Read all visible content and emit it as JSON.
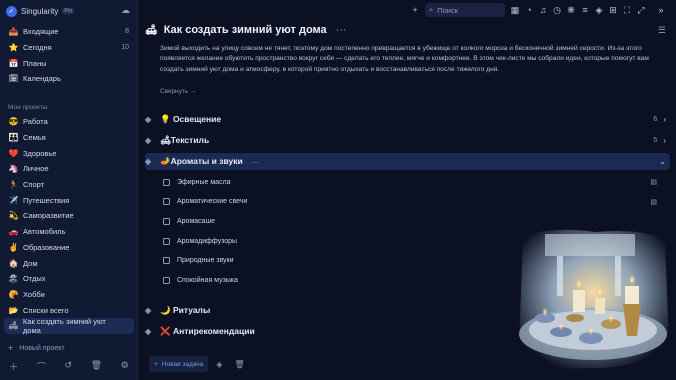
{
  "app": {
    "name": "Singularity",
    "badge": "Pro"
  },
  "sidebar": {
    "items": [
      {
        "label": "Входящие",
        "count": "8",
        "icon": "inbox-icon",
        "glyph": "📥"
      },
      {
        "label": "Сегодня",
        "count": "10",
        "icon": "star-icon",
        "glyph": "⭐"
      },
      {
        "label": "Планы",
        "count": "",
        "icon": "calendar-icon",
        "glyph": "📅"
      },
      {
        "label": "Календарь",
        "count": "",
        "icon": "calendar-grid-icon",
        "glyph": "🗓"
      }
    ],
    "projects_title": "Мои проекты",
    "projects": [
      {
        "label": "Работа",
        "glyph": "😎"
      },
      {
        "label": "Семья",
        "glyph": "👪"
      },
      {
        "label": "Здоровье",
        "glyph": "❤️"
      },
      {
        "label": "Личное",
        "glyph": "🦄"
      },
      {
        "label": "Спорт",
        "glyph": "🏃"
      },
      {
        "label": "Путешествия",
        "glyph": "✈️"
      },
      {
        "label": "Саморазвитие",
        "glyph": "💫"
      },
      {
        "label": "Автомобиль",
        "glyph": "🚗"
      },
      {
        "label": "Образование",
        "glyph": "✌️"
      },
      {
        "label": "Дом",
        "glyph": "🏠"
      },
      {
        "label": "Отдых",
        "glyph": "🏖"
      },
      {
        "label": "Хобби",
        "glyph": "🥐"
      },
      {
        "label": "Списки всего",
        "glyph": "📂"
      },
      {
        "label": "Как создать зимний уют дома",
        "glyph": "🛋"
      }
    ],
    "new_project": "Новый проект"
  },
  "topbar": {
    "search_placeholder": "Поиск"
  },
  "main": {
    "title": "Как создать зимний уют дома",
    "description": "Зимой выходить на улицу совсем не тянет, поэтому дом постепенно превращается в убежище от колкого мороза и бесконечной зимней серости. Из-за этого появляется желание обуютить пространство вокруг себя — сделать его теплее, мягче и комфортнее. В этом чек-листе мы собрали идеи, которые помогут вам создать зимний уют дома и атмосферу, в которой приятно отдыхать и восстанавливаться после тяжелого дня.",
    "collapse": "Свернуть",
    "sections": [
      {
        "label": "💡 Освещение",
        "count": "6"
      },
      {
        "label": "🛋Текстиль",
        "count": "5"
      },
      {
        "label": "🪔Ароматы и звуки",
        "count": ""
      },
      {
        "label": "🌙 Ритуалы",
        "count": ""
      },
      {
        "label": "❌ Антирекомендации",
        "count": ""
      }
    ],
    "tasks": [
      {
        "label": "Эфирные масла",
        "note": true
      },
      {
        "label": "Ароматические свечи",
        "note": true
      },
      {
        "label": "Аромасаше",
        "note": false
      },
      {
        "label": "Аромадиффузоры",
        "note": false
      },
      {
        "label": "Природные звуки",
        "note": false
      },
      {
        "label": "Спокойная музыка",
        "note": false
      }
    ],
    "new_task": "Новая задача"
  }
}
